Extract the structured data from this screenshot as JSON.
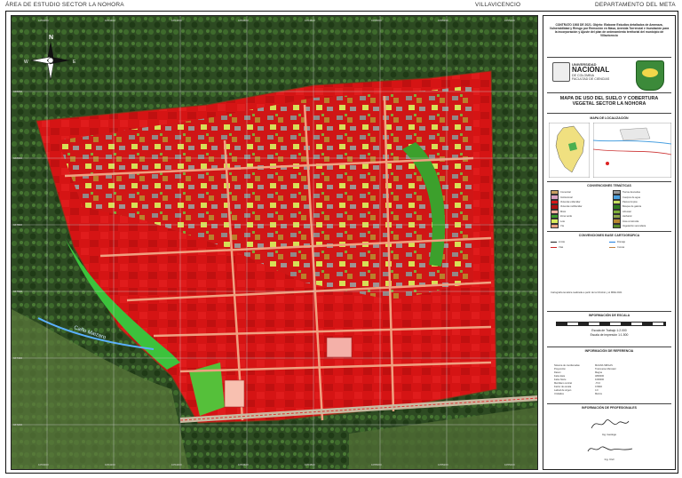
{
  "header": {
    "left": "ÁREA DE ESTUDIO SECTOR LA NOHORA",
    "center": "VILLAVICENCIO",
    "right": "DEPARTAMENTO DEL META"
  },
  "map": {
    "north_label_n": "N",
    "north_label_s": "S",
    "north_label_e": "E",
    "north_label_w": "W",
    "river_label": "Caño Maizaro"
  },
  "panel": {
    "contract_text": "CONTRATO 1008 DE 2021. Objeto: Elaborar Estudios detallados de Amenaza, Vulnerabilidad y Riesgo por Remoción en Masa, Avenida Torrencial e Inundación para la incorporación y Ajuste del plan de ordenamiento territorial del municipio de Villavicencio",
    "logo_un_line1": "UNIVERSIDAD",
    "logo_un_line2": "NACIONAL",
    "logo_un_line3": "DE COLOMBIA",
    "logo_un_line4": "FACULTAD DE CIENCIAS",
    "map_title": "MAPA DE USO DEL SUELO Y COBERTURA VEGETAL SECTOR LA NOHORA",
    "location_title": "MAPA DE LOCALIZACIÓN",
    "thematic_title": "CONVENCIONES TEMÁTICAS",
    "base_title": "CONVENCIONES BASE CARTOGRÁFICA",
    "scale_title": "INFORMACIÓN DE ESCALA",
    "scale_text": "Escala de Trabajo 1:2.000",
    "scale_text2": "Escala de impresión 1:1.500",
    "reference_title": "INFORMACIÓN DE REFERENCIA",
    "professionals_title": "INFORMACIÓN DE PROFESIONALES",
    "source_note": "Cartografía temática realizada a partir de la Ortofoto y el MDE 2021",
    "signature1": "Ing. Geólogo",
    "signature2": "Ing. Civil"
  },
  "legend_left": [
    {
      "label": "Comercial",
      "color": "#c8a060"
    },
    {
      "label": "Institucional",
      "color": "#d9a0c0"
    },
    {
      "label": "Vivienda unifamiliar",
      "color": "#d81818"
    },
    {
      "label": "Vivienda multifamiliar",
      "color": "#b01010"
    },
    {
      "label": "Mixto",
      "color": "#ffb0a0"
    },
    {
      "label": "Zona verde",
      "color": "#3c9a2c"
    },
    {
      "label": "Lote",
      "color": "#d7ea5a"
    },
    {
      "label": "Vía",
      "color": "#e8a080"
    }
  ],
  "legend_right": [
    {
      "label": "Tierras desnudas",
      "color": "#9a9a9a"
    },
    {
      "label": "Cuerpos de agua",
      "color": "#4aa0e0"
    },
    {
      "label": "Pastos limpios",
      "color": "#c6e060"
    },
    {
      "label": "Bosque de galería",
      "color": "#2f7a1e"
    },
    {
      "label": "Arbustal",
      "color": "#7fae3a"
    },
    {
      "label": "Herbazal",
      "color": "#8ea84a"
    },
    {
      "label": "Área construida",
      "color": "#b8862e"
    },
    {
      "label": "Vegetación secundaria",
      "color": "#5a8a2a"
    }
  ],
  "base_legend": [
    {
      "label": "Límite",
      "color": "#222222"
    },
    {
      "label": "Drenaje",
      "color": "#2080e0"
    },
    {
      "label": "Vías",
      "color": "#cc2222"
    },
    {
      "label": "Curvas",
      "color": "#c08040"
    }
  ],
  "reference": [
    {
      "k": "Sistema de coordenadas",
      "v": "MAGNA SIRGAS"
    },
    {
      "k": "Proyección",
      "v": "Transverse Mercator"
    },
    {
      "k": "Datum",
      "v": "Magna"
    },
    {
      "k": "Falso Este",
      "v": "4800000"
    },
    {
      "k": "Falso Norte",
      "v": "1000000"
    },
    {
      "k": "Meridiano central",
      "v": "-73.0"
    },
    {
      "k": "Factor de escala",
      "v": "0.9992"
    },
    {
      "k": "Latitud de origen",
      "v": "4.0"
    },
    {
      "k": "Unidades",
      "v": "Metros"
    }
  ],
  "grid_labels_top": [
    "1054000",
    "1054200",
    "1054400",
    "1054600",
    "1054800",
    "1055000",
    "1055200",
    "1055400"
  ],
  "grid_labels_left": [
    "948200",
    "948000",
    "947800",
    "947600",
    "947400",
    "947200"
  ]
}
